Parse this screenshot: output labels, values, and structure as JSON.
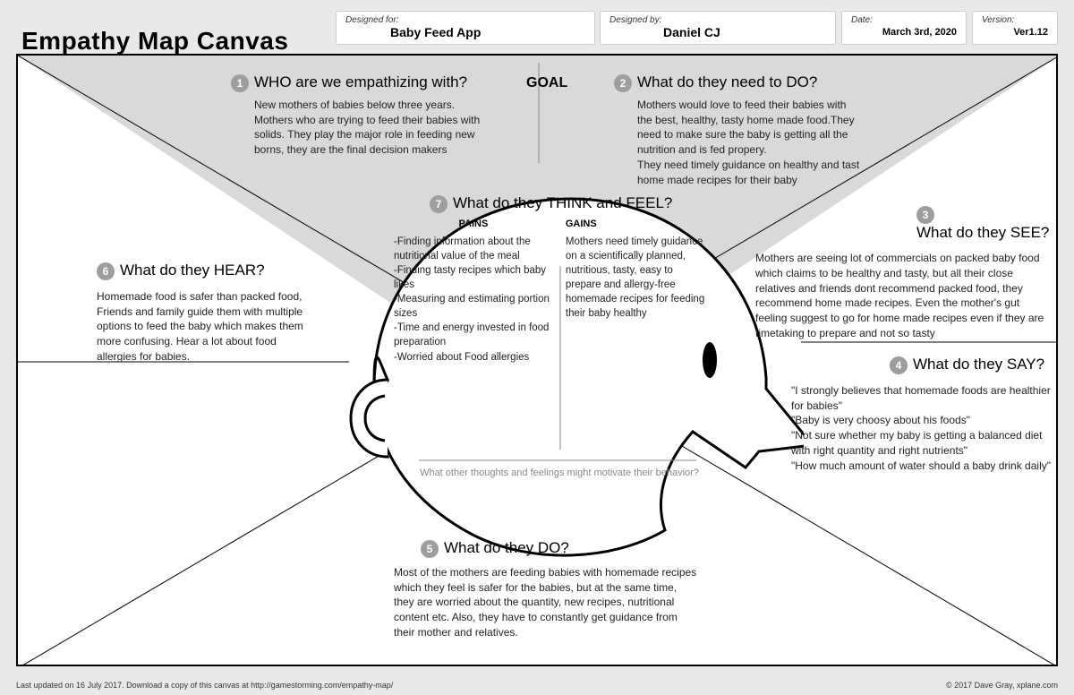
{
  "title": "Empathy Map Canvas",
  "meta": {
    "designed_for_label": "Designed for:",
    "designed_for": "Baby Feed App",
    "designed_by_label": "Designed by:",
    "designed_by": "Daniel CJ",
    "date_label": "Date:",
    "date": "March 3rd, 2020",
    "version_label": "Version:",
    "version": "Ver1.12"
  },
  "goal": "GOAL",
  "sections": {
    "s1": {
      "n": "1",
      "title": "WHO are we empathizing with?",
      "body": "New mothers of babies below three years. Mothers who are trying to feed their babies with solids. They play the major role in feeding new borns, they are the final decision makers"
    },
    "s2": {
      "n": "2",
      "title": "What do they need to DO?",
      "body": "Mothers would love to feed their babies with the best, healthy, tasty home made food.They need to make sure the baby is getting all the nutrition and is fed propery.\nThey need timely guidance on healthy and tast home made recipes for their baby"
    },
    "s3": {
      "n": "3",
      "title": "What do they SEE?",
      "body": "Mothers are seeing lot of commercials on packed baby food which claims to be healthy and tasty, but all their close relatives and friends dont recommend packed food, they recommend home made recipes. Even the mother's gut feeling suggest  to go for home made recipes even if they are timetaking to prepare and not so tasty"
    },
    "s4": {
      "n": "4",
      "title": "What do they SAY?",
      "body": "\"I strongly believes that homemade foods are healthier for babies\"\n\"Baby is very choosy about his foods\"\n\"Not sure whether my baby is getting a balanced diet with right quantity and right nutrients\"\n\"How much amount of water should a baby drink daily\""
    },
    "s5": {
      "n": "5",
      "title": "What do they DO?",
      "body": "Most of the mothers are feeding babies with homemade recipes which they feel is safer for the babies, but at the same time, they are worried about the quantity, new recipes, nutritional content etc. Also, they have to constantly get guidance from their mother and relatives."
    },
    "s6": {
      "n": "6",
      "title": "What do they HEAR?",
      "body": "Homemade food is safer than packed food, Friends and family guide them with multiple options to feed the baby which makes them more confusing. Hear a lot about food allergies for babies."
    },
    "s7": {
      "n": "7",
      "title": "What do they THINK and FEEL?",
      "pains_label": "PAINS",
      "gains_label": "GAINS",
      "pains": "-Finding information about the nutritional value of the meal\n-Finding tasty recipes which baby likes\n-Measuring and estimating portion sizes\n-Time and energy invested in food preparation\n-Worried about Food allergies",
      "gains": "Mothers need timely guidance on a scientifically  planned, nutritious, tasty, easy to prepare and allergy-free homemade recipes for feeding their baby healthy"
    },
    "prompt": "What other thoughts and feelings might motivate their behavior?"
  },
  "footer": {
    "left": "Last updated on 16 July 2017. Download a copy of this canvas at http://gamestorming.com/empathy-map/",
    "right": "© 2017 Dave Gray, xplane.com"
  }
}
